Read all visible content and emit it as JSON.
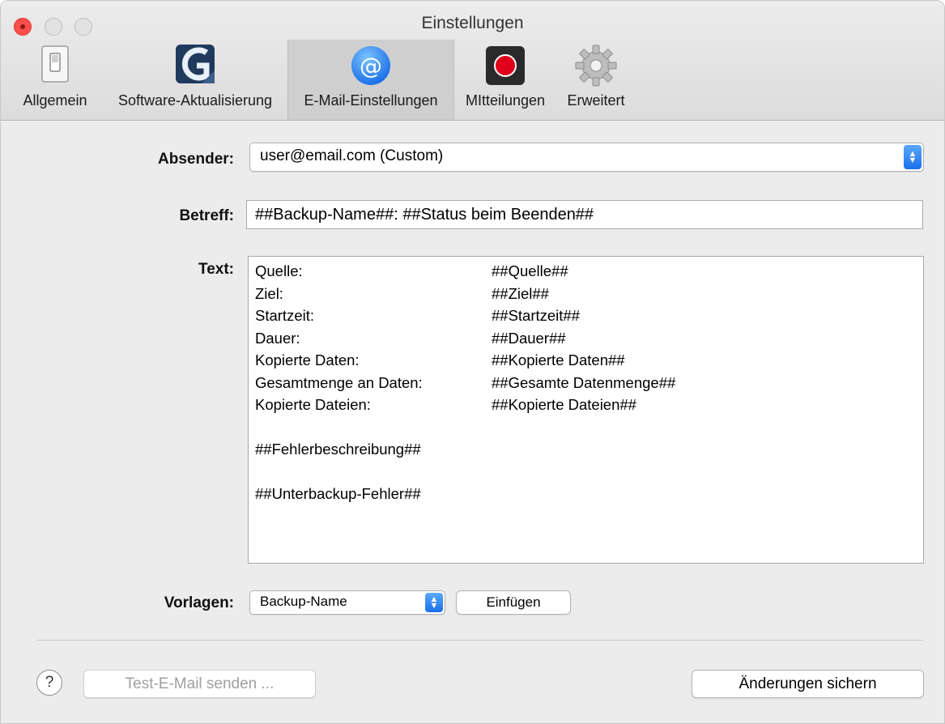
{
  "window": {
    "title": "Einstellungen"
  },
  "tabs": [
    {
      "label": "Allgemein",
      "icon": "switch-icon"
    },
    {
      "label": "Software-Aktualisierung",
      "icon": "app-logo-icon"
    },
    {
      "label": "E-Mail-Einstellungen",
      "icon": "at-sign-icon",
      "selected": true
    },
    {
      "label": "MItteilungen",
      "icon": "record-icon"
    },
    {
      "label": "Erweitert",
      "icon": "gear-icon"
    }
  ],
  "form": {
    "sender": {
      "label": "Absender:",
      "value": "user@email.com (Custom)"
    },
    "subject": {
      "label": "Betreff:",
      "value": "##Backup-Name##: ##Status beim Beenden##"
    },
    "text": {
      "label": "Text:",
      "rows": [
        {
          "key": "Quelle:",
          "value": "##Quelle##"
        },
        {
          "key": "Ziel:",
          "value": "##Ziel##"
        },
        {
          "key": "Startzeit:",
          "value": "##Startzeit##"
        },
        {
          "key": "Dauer:",
          "value": "##Dauer##"
        },
        {
          "key": "Kopierte Daten:",
          "value": "##Kopierte Daten##"
        },
        {
          "key": "Gesamtmenge an Daten:",
          "value": "##Gesamte Datenmenge##"
        },
        {
          "key": "Kopierte Dateien:",
          "value": "##Kopierte Dateien##"
        }
      ],
      "extra_lines": [
        "##Fehlerbeschreibung##",
        "##Unterbackup-Fehler##"
      ]
    },
    "templates": {
      "label": "Vorlagen:",
      "value": "Backup-Name",
      "insert_label": "Einfügen"
    }
  },
  "footer": {
    "help_label": "?",
    "test_button": "Test-E-Mail senden ...",
    "save_button": "Änderungen sichern"
  },
  "colors": {
    "accent": "#1b6fe8",
    "close": "#fc4e4a",
    "record": "#e0001a"
  }
}
